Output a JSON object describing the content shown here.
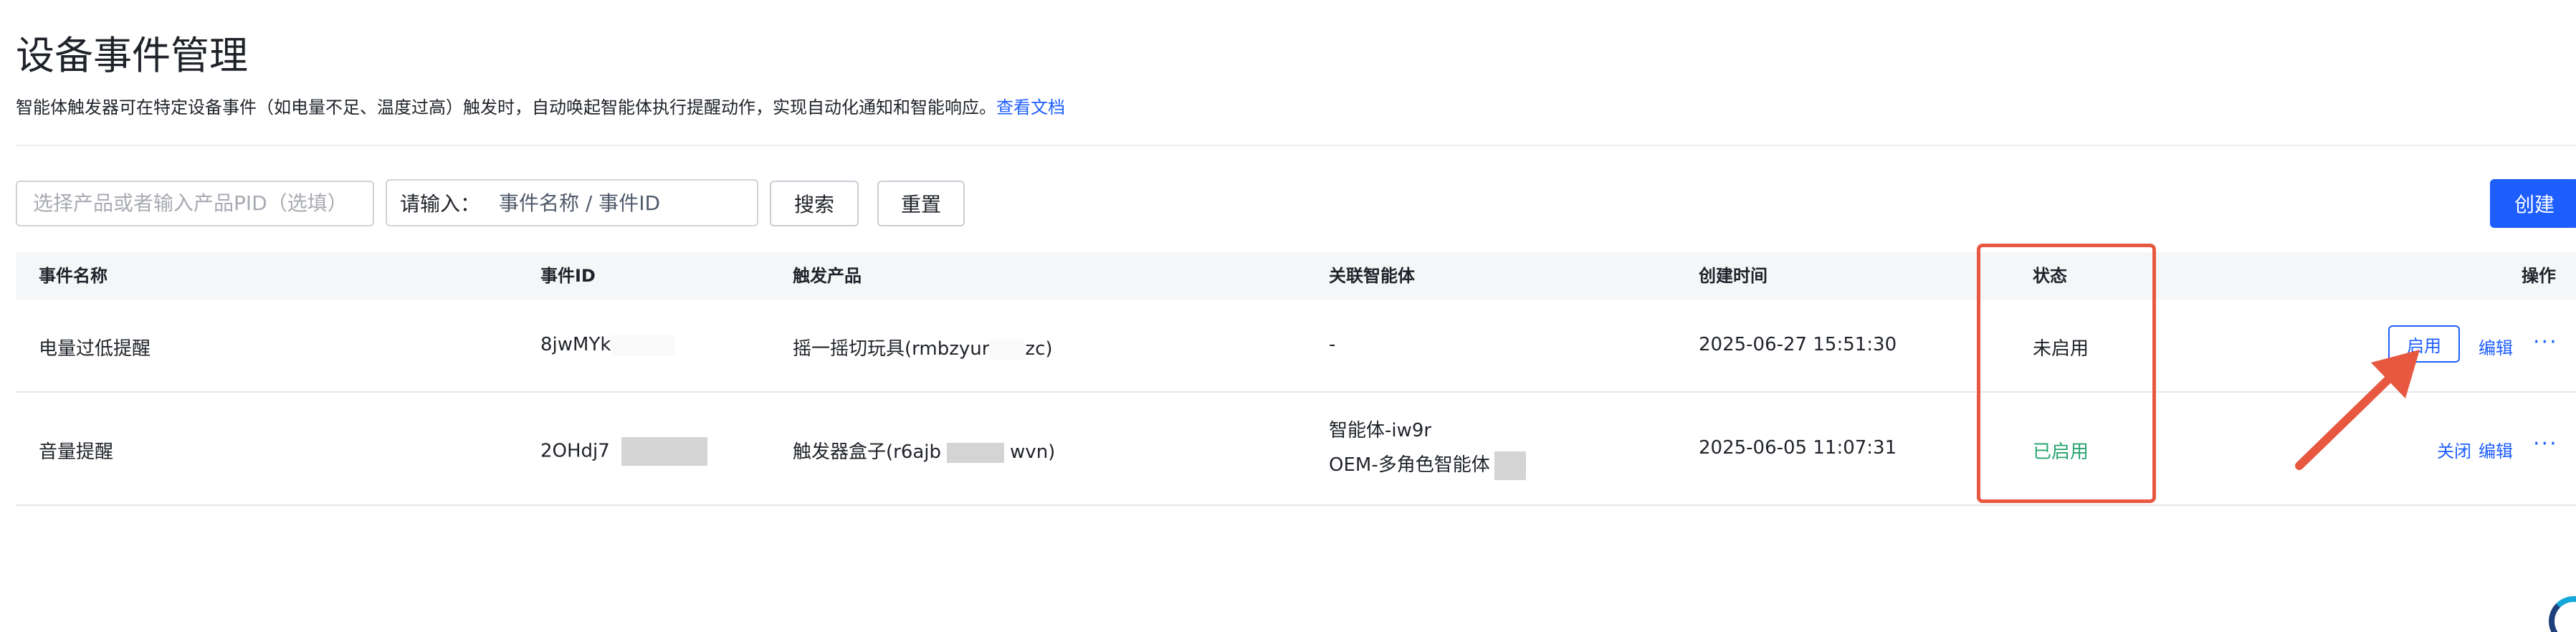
{
  "header": {
    "title": "设备事件管理",
    "description": "智能体触发器可在特定设备事件（如电量不足、温度过高）触发时，自动唤起智能体执行提醒动作，实现自动化通知和智能响应。",
    "doc_link": "查看文档"
  },
  "toolbar": {
    "product_placeholder": "选择产品或者输入产品PID（选填）",
    "keyword_label": "请输入：",
    "keyword_placeholder": "事件名称 / 事件ID",
    "search_label": "搜索",
    "reset_label": "重置",
    "create_label": "创建"
  },
  "table": {
    "columns": [
      "事件名称",
      "事件ID",
      "触发产品",
      "关联智能体",
      "创建时间",
      "状态",
      "操作"
    ],
    "rows": [
      {
        "name": "电量过低提醒",
        "event_id": "8jwMYk",
        "product_prefix": "摇一摇切玩具(rmbzyur",
        "product_suffix": "zc)",
        "agents": [
          "-"
        ],
        "created": "2025-06-27 15:51:30",
        "status": "未启用",
        "actions": {
          "toggle": "启用",
          "edit": "编辑",
          "more": "···"
        }
      },
      {
        "name": "音量提醒",
        "event_id": "2OHdj7",
        "product_prefix": "触发器盒子(r6ajb",
        "product_suffix": "wvn)",
        "agents": [
          "智能体-iw9r",
          "OEM-多角色智能体"
        ],
        "created": "2025-06-05 11:07:31",
        "status": "已启用",
        "actions": {
          "toggle": "关闭",
          "edit": "编辑",
          "more": "···"
        }
      }
    ]
  },
  "colors": {
    "primary": "#1e5eff",
    "status_enabled": "#2ba471",
    "annotation": "#e8573f"
  },
  "icons": [
    "more-icon",
    "annotation-arrow-icon",
    "logo-icon"
  ]
}
